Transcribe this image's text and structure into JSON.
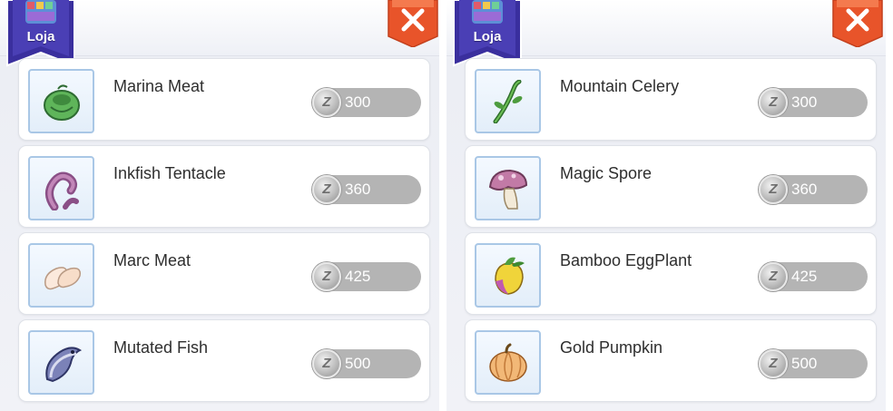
{
  "panels": [
    {
      "shop_label": "Loja",
      "items": [
        {
          "name": "Marina Meat",
          "price": "300",
          "icon": "cabbage-meat-icon"
        },
        {
          "name": "Inkfish Tentacle",
          "price": "360",
          "icon": "tentacle-icon"
        },
        {
          "name": "Marc Meat",
          "price": "425",
          "icon": "meat-slices-icon"
        },
        {
          "name": "Mutated Fish",
          "price": "500",
          "icon": "fish-icon"
        }
      ]
    },
    {
      "shop_label": "Loja",
      "items": [
        {
          "name": "Mountain Celery",
          "price": "300",
          "icon": "celery-icon"
        },
        {
          "name": "Magic Spore",
          "price": "360",
          "icon": "mushroom-icon"
        },
        {
          "name": "Bamboo EggPlant",
          "price": "425",
          "icon": "eggplant-icon"
        },
        {
          "name": "Gold Pumpkin",
          "price": "500",
          "icon": "pumpkin-icon"
        }
      ]
    }
  ],
  "currency_symbol": "Z",
  "colors": {
    "banner": "#3a2f9e",
    "close_button": "#e8542a",
    "price_pill": "#b4b4b4",
    "icon_frame_border": "#a9c7e6"
  }
}
